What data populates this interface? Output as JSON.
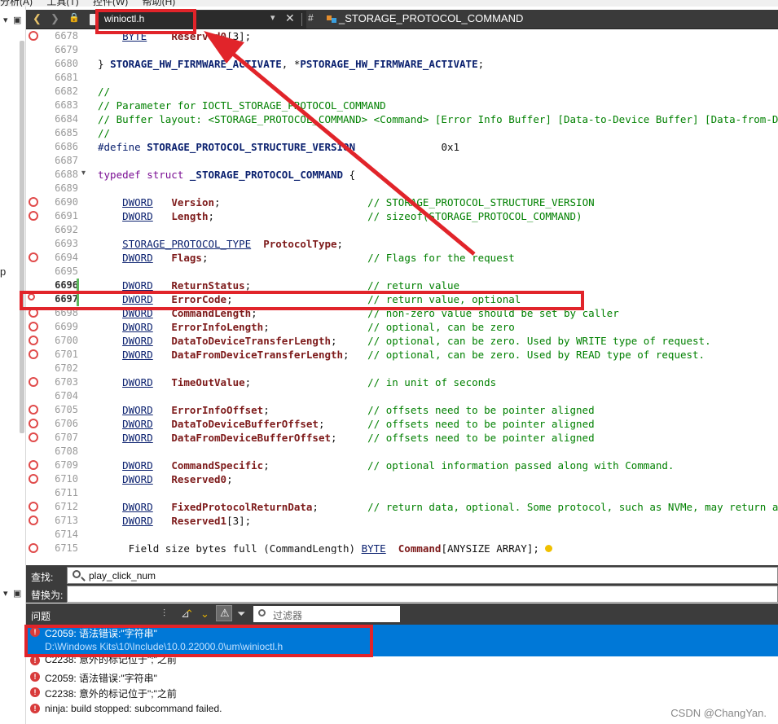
{
  "menubar": {
    "items": "分析(A)  工具(T)  控件(W)  帮助(H)"
  },
  "tabs": {
    "file_name": "winioctl.h",
    "hash": "#",
    "symbol": "_STORAGE_PROTOCOL_COMMAND"
  },
  "left_strip": {
    "letter": "p"
  },
  "editor": {
    "lines": [
      {
        "num": "6678",
        "text": "    BYTE    Reserved0[3];"
      },
      {
        "num": "6679",
        "text": ""
      },
      {
        "num": "6680",
        "text": "} STORAGE_HW_FIRMWARE_ACTIVATE, *PSTORAGE_HW_FIRMWARE_ACTIVATE;"
      },
      {
        "num": "6681",
        "text": ""
      },
      {
        "num": "6682",
        "text": "//"
      },
      {
        "num": "6683",
        "text": "// Parameter for IOCTL_STORAGE_PROTOCOL_COMMAND"
      },
      {
        "num": "6684",
        "text": "// Buffer layout: <STORAGE_PROTOCOL_COMMAND> <Command> [Error Info Buffer] [Data-to-Device Buffer] [Data-from-Device Buffer]"
      },
      {
        "num": "6685",
        "text": "//"
      },
      {
        "num": "6686",
        "text": "#define STORAGE_PROTOCOL_STRUCTURE_VERSION              0x1"
      },
      {
        "num": "6687",
        "text": ""
      },
      {
        "num": "6688",
        "text": "typedef struct _STORAGE_PROTOCOL_COMMAND {"
      },
      {
        "num": "6689",
        "text": ""
      },
      {
        "num": "6690",
        "text": "    DWORD   Version;                        // STORAGE_PROTOCOL_STRUCTURE_VERSION"
      },
      {
        "num": "6691",
        "text": "    DWORD   Length;                         // sizeof(STORAGE_PROTOCOL_COMMAND)"
      },
      {
        "num": "6692",
        "text": ""
      },
      {
        "num": "6693",
        "text": "    STORAGE_PROTOCOL_TYPE  ProtocolType;"
      },
      {
        "num": "6694",
        "text": "    DWORD   Flags;                          // Flags for the request"
      },
      {
        "num": "6695",
        "text": ""
      },
      {
        "num": "6696",
        "text": "    DWORD   ReturnStatus;                   // return value"
      },
      {
        "num": "6697",
        "text": "    DWORD   ErrorCode;                      // return value, optional"
      },
      {
        "num": "6698",
        "text": "    DWORD   CommandLength;                  // non-zero value should be set by caller"
      },
      {
        "num": "6699",
        "text": "    DWORD   ErrorInfoLength;                // optional, can be zero"
      },
      {
        "num": "6700",
        "text": "    DWORD   DataToDeviceTransferLength;     // optional, can be zero. Used by WRITE type of request."
      },
      {
        "num": "6701",
        "text": "    DWORD   DataFromDeviceTransferLength;   // optional, can be zero. Used by READ type of request."
      },
      {
        "num": "6702",
        "text": ""
      },
      {
        "num": "6703",
        "text": "    DWORD   TimeOutValue;                   // in unit of seconds"
      },
      {
        "num": "6704",
        "text": ""
      },
      {
        "num": "6705",
        "text": "    DWORD   ErrorInfoOffset;                // offsets need to be pointer aligned"
      },
      {
        "num": "6706",
        "text": "    DWORD   DataToDeviceBufferOffset;       // offsets need to be pointer aligned"
      },
      {
        "num": "6707",
        "text": "    DWORD   DataFromDeviceBufferOffset;     // offsets need to be pointer aligned"
      },
      {
        "num": "6708",
        "text": ""
      },
      {
        "num": "6709",
        "text": "    DWORD   CommandSpecific;                // optional information passed along with Command."
      },
      {
        "num": "6710",
        "text": "    DWORD   Reserved0;"
      },
      {
        "num": "6711",
        "text": ""
      },
      {
        "num": "6712",
        "text": "    DWORD   FixedProtocolReturnData;        // return data, optional. Some protocol, such as NVMe, may return a small amount data (DWORD0 from completion queue entry) without the need of separate device data transfer."
      },
      {
        "num": "6713",
        "text": "    DWORD   Reserved1[3];"
      },
      {
        "num": "6714",
        "text": ""
      },
      {
        "num": "6715",
        "text": "     Field_size_bytes_full_(CommandLength) BYTE  Command[ANYSIZE_ARRAY];"
      }
    ]
  },
  "find": {
    "find_label": "查找:",
    "find_value": "play_click_num",
    "replace_label": "替换为:",
    "replace_value": ""
  },
  "problems": {
    "title": "问题",
    "filter_placeholder": "过滤器",
    "items": [
      {
        "message": "C2059: 语法错误:\"字符串\"",
        "path": "D:\\Windows Kits\\10\\Include\\10.0.22000.0\\um\\winioctl.h",
        "selected": true
      },
      {
        "message": "C2238: 意外的标记位于\";\"之前"
      },
      {
        "message": "C2059: 语法错误:\"字符串\""
      },
      {
        "message": "C2238: 意外的标记位于\";\"之前"
      },
      {
        "message": "ninja: build stopped: subcommand failed."
      }
    ]
  },
  "watermark": "CSDN @ChangYan.",
  "colors": {
    "annotation_red": "#e1242a",
    "selection_blue": "#0078d7",
    "comment_green": "#008000",
    "keyword_purple": "#7a0d93"
  }
}
